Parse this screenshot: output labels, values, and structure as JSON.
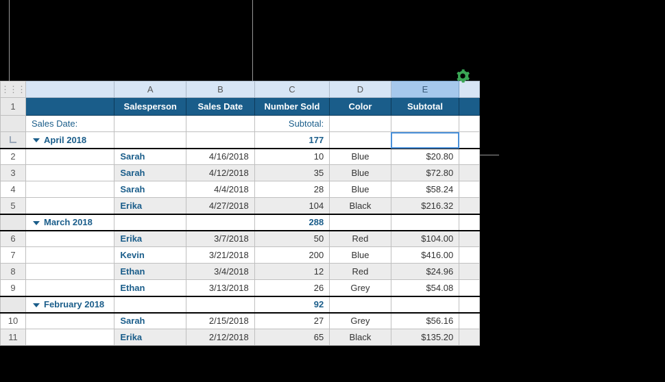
{
  "columns": {
    "A": "A",
    "B": "B",
    "C": "C",
    "D": "D",
    "E": "E"
  },
  "headers": {
    "salesperson": "Salesperson",
    "sales_date": "Sales Date",
    "number_sold": "Number Sold",
    "color": "Color",
    "subtotal": "Subtotal"
  },
  "labels": {
    "sales_date": "Sales Date:",
    "subtotal": "Subtotal:"
  },
  "groups": [
    {
      "title": "April 2018",
      "sum": "177",
      "rows": [
        {
          "n": "2",
          "person": "Sarah",
          "date": "4/16/2018",
          "sold": "10",
          "color": "Blue",
          "sub": "$20.80"
        },
        {
          "n": "3",
          "person": "Sarah",
          "date": "4/12/2018",
          "sold": "35",
          "color": "Blue",
          "sub": "$72.80"
        },
        {
          "n": "4",
          "person": "Sarah",
          "date": "4/4/2018",
          "sold": "28",
          "color": "Blue",
          "sub": "$58.24"
        },
        {
          "n": "5",
          "person": "Erika",
          "date": "4/27/2018",
          "sold": "104",
          "color": "Black",
          "sub": "$216.32"
        }
      ]
    },
    {
      "title": "March 2018",
      "sum": "288",
      "rows": [
        {
          "n": "6",
          "person": "Erika",
          "date": "3/7/2018",
          "sold": "50",
          "color": "Red",
          "sub": "$104.00"
        },
        {
          "n": "7",
          "person": "Kevin",
          "date": "3/21/2018",
          "sold": "200",
          "color": "Blue",
          "sub": "$416.00"
        },
        {
          "n": "8",
          "person": "Ethan",
          "date": "3/4/2018",
          "sold": "12",
          "color": "Red",
          "sub": "$24.96"
        },
        {
          "n": "9",
          "person": "Ethan",
          "date": "3/13/2018",
          "sold": "26",
          "color": "Grey",
          "sub": "$54.08"
        }
      ]
    },
    {
      "title": "February 2018",
      "sum": "92",
      "rows": [
        {
          "n": "10",
          "person": "Sarah",
          "date": "2/15/2018",
          "sold": "27",
          "color": "Grey",
          "sub": "$56.16"
        },
        {
          "n": "11",
          "person": "Erika",
          "date": "2/12/2018",
          "sold": "65",
          "color": "Black",
          "sub": "$135.20"
        }
      ]
    }
  ],
  "row1": "1"
}
